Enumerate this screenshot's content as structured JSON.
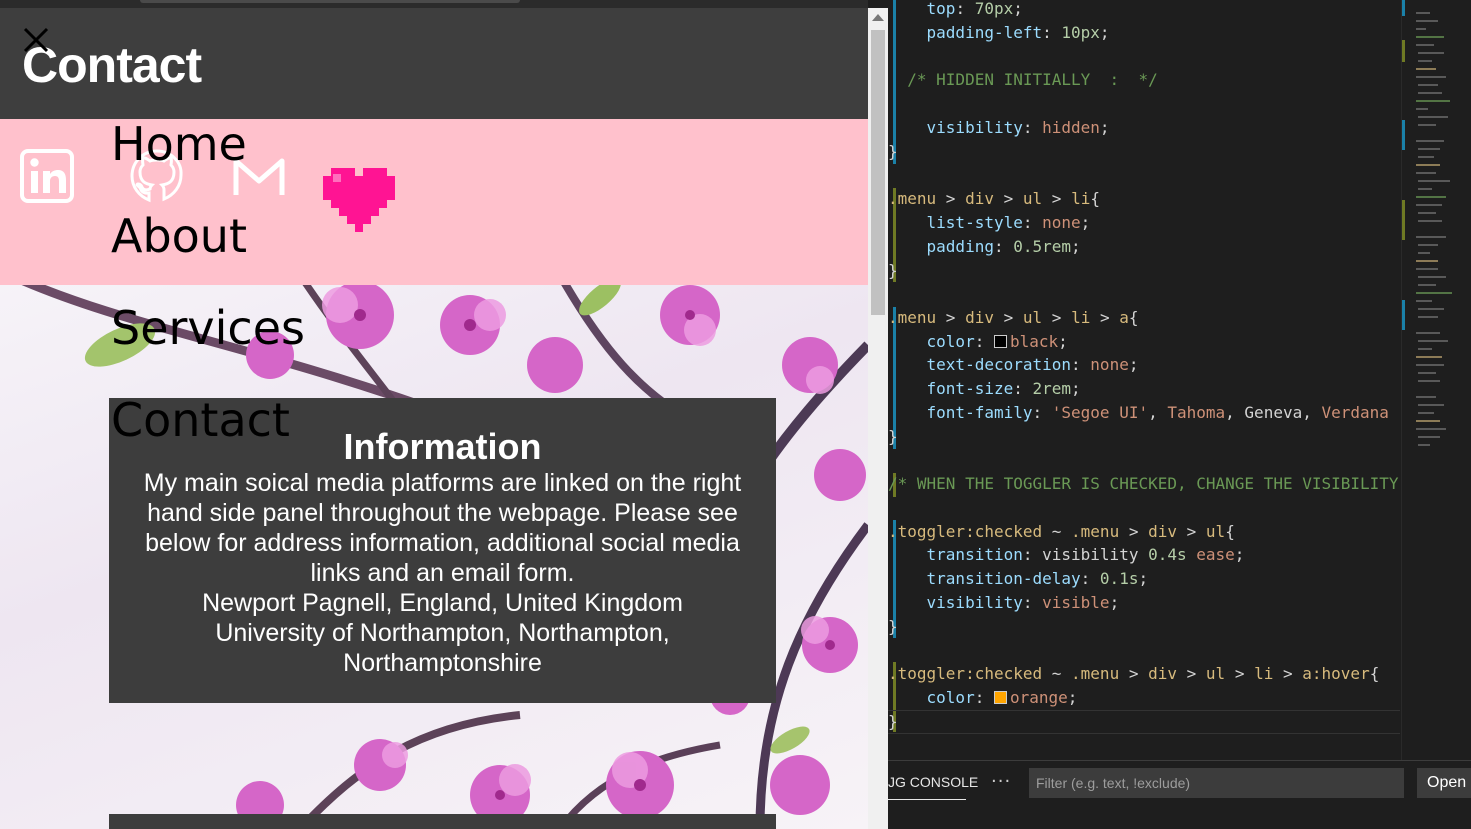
{
  "preview": {
    "site_title": "Contact",
    "menu": [
      "Home",
      "About",
      "Services",
      "Contact"
    ],
    "social": [
      "linkedin-icon",
      "github-icon",
      "gmail-icon",
      "heart-icon"
    ],
    "info": {
      "title": "Information",
      "body": "My main soical media platforms are linked on the right hand side panel throughout the webpage. Please see below for address information, additional social media links and an email form.",
      "address_line1": "Newport Pagnell, England, United Kingdom",
      "address_line2": "University of Northampton, Northampton, Northamptonshire"
    },
    "colors": {
      "header": "#3e3e3e",
      "pink_band": "#ffc1cc",
      "heart": "#ff1493",
      "card": "#3d3d3d"
    }
  },
  "editor": {
    "colors": {
      "black_swatch": "#000000",
      "orange_swatch": "#ffa500",
      "property": "#9cdcfe",
      "value": "#ce9178",
      "comment": "#6a9955"
    }
  },
  "panel": {
    "tab_label": "JG CONSOLE",
    "more": "···",
    "filter_placeholder": "Filter (e.g. text, !exclude)",
    "open_label": "Open"
  }
}
